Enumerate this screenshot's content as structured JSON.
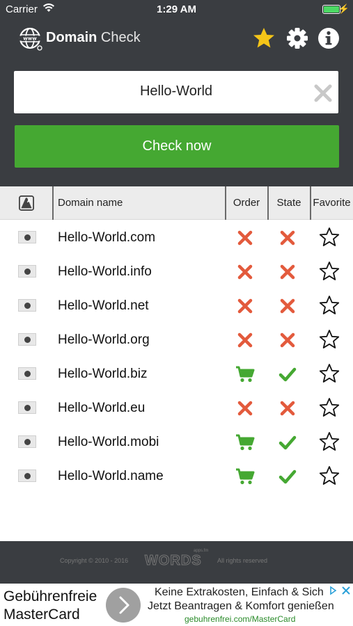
{
  "status_bar": {
    "carrier": "Carrier",
    "time": "1:29 AM"
  },
  "header": {
    "title_bold": "Domain",
    "title_light": "Check"
  },
  "search": {
    "value": "Hello-World"
  },
  "check_button": {
    "label": "Check now"
  },
  "table": {
    "columns": {
      "name": "Domain name",
      "order": "Order",
      "state": "State",
      "favorite": "Favorite"
    },
    "rows": [
      {
        "domain": "Hello-World.com",
        "order": "unavailable",
        "state": "taken",
        "favorite": false
      },
      {
        "domain": "Hello-World.info",
        "order": "unavailable",
        "state": "taken",
        "favorite": false
      },
      {
        "domain": "Hello-World.net",
        "order": "unavailable",
        "state": "taken",
        "favorite": false
      },
      {
        "domain": "Hello-World.org",
        "order": "unavailable",
        "state": "taken",
        "favorite": false
      },
      {
        "domain": "Hello-World.biz",
        "order": "cart",
        "state": "available",
        "favorite": false
      },
      {
        "domain": "Hello-World.eu",
        "order": "unavailable",
        "state": "taken",
        "favorite": false
      },
      {
        "domain": "Hello-World.mobi",
        "order": "cart",
        "state": "available",
        "favorite": false
      },
      {
        "domain": "Hello-World.name",
        "order": "cart",
        "state": "available",
        "favorite": false
      }
    ]
  },
  "footer": {
    "copyright": "Copyright © 2010 - 2016",
    "brand": "WORDS",
    "brand_sub": "apps.fm",
    "rights": "All rights reserved"
  },
  "ad": {
    "left_line1": "Gebührenfreie",
    "left_line2": "MasterCard",
    "line1": "Keine Extrakosten, Einfach & Sich",
    "line2": "Jetzt Beantragen & Komfort genießen",
    "url": "gebuhrenfrei.com/MasterCard"
  },
  "colors": {
    "dark_bg": "#3a3d41",
    "green": "#45a832",
    "red": "#e35a3c",
    "star_gold": "#f5c518"
  },
  "icons": {
    "clear": "clear-icon",
    "favorites": "star-icon",
    "settings": "gear-icon",
    "info": "info-icon",
    "globe": "globe-icon",
    "cart": "cart-icon",
    "cross": "cross-icon",
    "check": "check-icon"
  }
}
